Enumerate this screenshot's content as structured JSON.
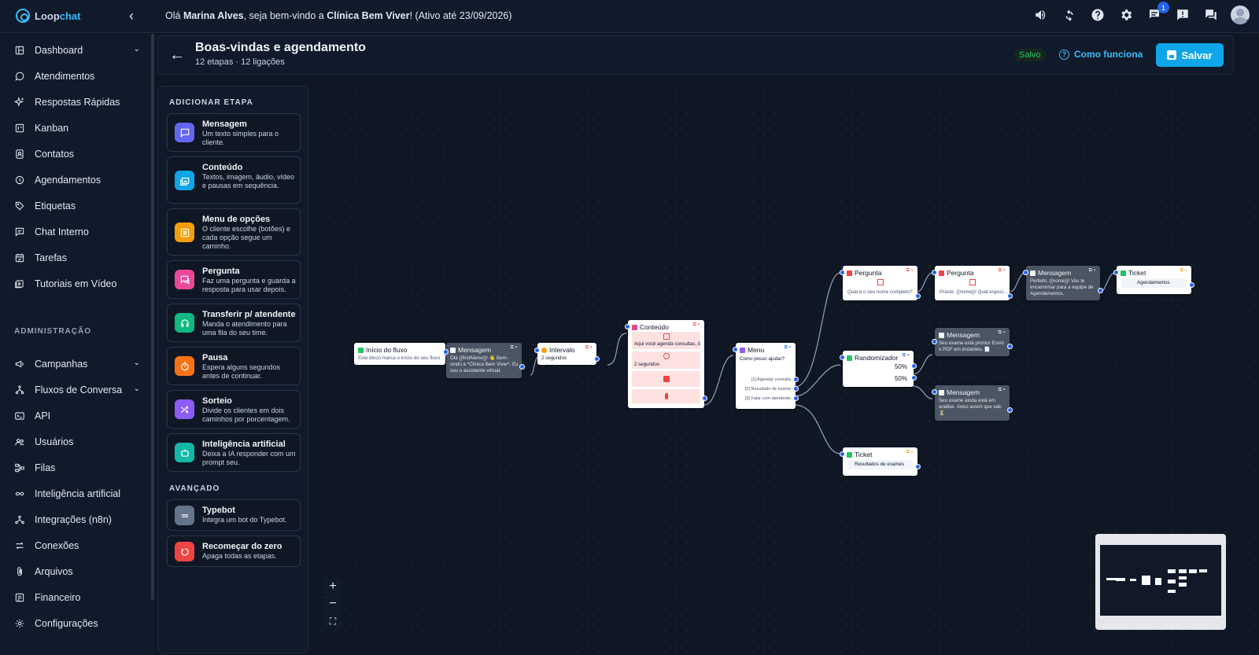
{
  "app": {
    "logo_part1": "Loop",
    "logo_part2": "chat",
    "greeting_prefix": "Olá ",
    "user": "Marina Alves",
    "greeting_mid": ", seja bem-vindo a ",
    "company": "Clínica Bem Viver",
    "greeting_suffix": "! (Ativo até 23/09/2026)",
    "notification_count": "1"
  },
  "sidebar": {
    "items": [
      {
        "label": "Dashboard",
        "icon": "dashboard-icon"
      },
      {
        "label": "Atendimentos",
        "icon": "whatsapp-icon"
      },
      {
        "label": "Respostas Rápidas",
        "icon": "sparkles-icon"
      },
      {
        "label": "Kanban",
        "icon": "kanban-icon"
      },
      {
        "label": "Contatos",
        "icon": "contact-icon"
      },
      {
        "label": "Agendamentos",
        "icon": "clock-icon"
      },
      {
        "label": "Etiquetas",
        "icon": "tag-icon"
      },
      {
        "label": "Chat Interno",
        "icon": "chat-icon"
      },
      {
        "label": "Tarefas",
        "icon": "calendar-check-icon"
      },
      {
        "label": "Tutoriais em Vídeo",
        "icon": "video-icon"
      }
    ],
    "admin_section": "ADMINISTRAÇÃO",
    "admin_items": [
      {
        "label": "Campanhas",
        "icon": "megaphone-icon"
      },
      {
        "label": "Fluxos de Conversa",
        "icon": "flow-icon"
      },
      {
        "label": "API",
        "icon": "terminal-icon"
      },
      {
        "label": "Usuários",
        "icon": "users-icon"
      },
      {
        "label": "Filas",
        "icon": "queue-icon"
      },
      {
        "label": "Inteligência artificial",
        "icon": "infinity-icon"
      },
      {
        "label": "Integrações (n8n)",
        "icon": "integration-icon"
      },
      {
        "label": "Conexões",
        "icon": "arrows-icon"
      },
      {
        "label": "Arquivos",
        "icon": "paperclip-icon"
      },
      {
        "label": "Financeiro",
        "icon": "finance-icon"
      },
      {
        "label": "Configurações",
        "icon": "gear-icon"
      }
    ]
  },
  "header": {
    "title": "Boas-vindas e agendamento",
    "subtitle": "12 etapas · 12 ligações",
    "saved": "Salvo",
    "how_it_works": "Como funciona",
    "save": "Salvar"
  },
  "palette": {
    "section1": "ADICIONAR ETAPA",
    "items": [
      {
        "name": "Mensagem",
        "desc": "Um texto simples para o cliente.",
        "color": "#6366f1"
      },
      {
        "name": "Conteúdo",
        "desc": "Textos, imagem, áudio, vídeo e pausas em sequência.",
        "color": "#0ea5e9"
      },
      {
        "name": "Menu de opções",
        "desc": "O cliente escolhe (botões) e cada opção segue um caminho.",
        "color": "#f59e0b"
      },
      {
        "name": "Pergunta",
        "desc": "Faz uma pergunta e guarda a resposta para usar depois.",
        "color": "#ec4899"
      },
      {
        "name": "Transferir p/ atendente",
        "desc": "Manda o atendimento para uma fila do seu time.",
        "color": "#10b981"
      },
      {
        "name": "Pausa",
        "desc": "Espera alguns segundos antes de continuar.",
        "color": "#f97316"
      },
      {
        "name": "Sorteio",
        "desc": "Divide os clientes em dois caminhos por porcentagem.",
        "color": "#8b5cf6"
      },
      {
        "name": "Inteligência artificial",
        "desc": "Deixa a IA responder com um prompt seu.",
        "color": "#14b8a6"
      }
    ],
    "section2": "AVANÇADO",
    "advanced": [
      {
        "name": "Typebot",
        "desc": "Integra um bot do Typebot.",
        "color": "#64748b"
      },
      {
        "name": "Recomeçar do zero",
        "desc": "Apaga todas as etapas.",
        "color": "#ef4444"
      }
    ]
  },
  "flow": {
    "start": {
      "title": "Início do fluxo",
      "desc": "Este bloco marca o início do seu fluxo"
    },
    "msg1": {
      "title": "Mensagem",
      "desc": "Olá {{firstName}}! 👋 Bem-vindo à *Clínica Bem Viver*. Eu sou o assistente virtual."
    },
    "interval": {
      "title": "Intervalo",
      "desc": "2 segundos"
    },
    "content": {
      "title": "Conteúdo",
      "desc": "Aqui você agenda consultas, tir...",
      "pause": "2 segundos"
    },
    "menu": {
      "title": "Menu",
      "desc": "Como posso ajudar?",
      "options": [
        "[1] Agendar consulta",
        "[2] Resultado de exame",
        "[3] Falar com atendente"
      ]
    },
    "q1": {
      "title": "Pergunta",
      "desc": "Qual é o seu nome completo?"
    },
    "q2": {
      "title": "Pergunta",
      "desc": "Prazer, {{nome}}! Qual especi..."
    },
    "msg2": {
      "title": "Mensagem",
      "desc": "Perfeito, {{nome}}! Vou te encaminhar para a equipe de Agendamentos."
    },
    "ticket1": {
      "title": "Ticket",
      "desc": "Agendamentos"
    },
    "random": {
      "title": "Randomizador",
      "a": "50%",
      "b": "50%"
    },
    "msg3": {
      "title": "Mensagem",
      "desc": "Seu exame está pronto! Envio o PDF em instantes. 📄"
    },
    "msg4": {
      "title": "Mensagem",
      "desc": "Seu exame ainda está em análise. Aviso assim que sair. ⏳"
    },
    "ticket2": {
      "title": "Ticket",
      "desc": "Resultados de exames"
    }
  },
  "zoom": {
    "in": "+",
    "out": "−",
    "fit": "⛶"
  }
}
